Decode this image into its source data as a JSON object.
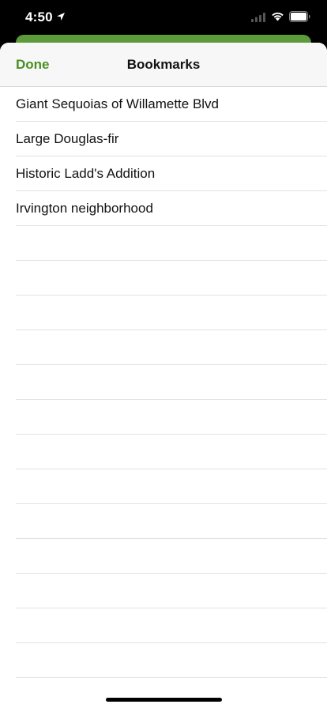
{
  "status_bar": {
    "time": "4:50"
  },
  "nav": {
    "done_label": "Done",
    "title": "Bookmarks"
  },
  "bookmarks": [
    "Giant Sequoias of Willamette Blvd",
    "Large Douglas-fir",
    "Historic Ladd's Addition",
    "Irvington neighborhood"
  ],
  "colors": {
    "accent": "#4a8f22",
    "behind_card": "#5c9a3a"
  }
}
